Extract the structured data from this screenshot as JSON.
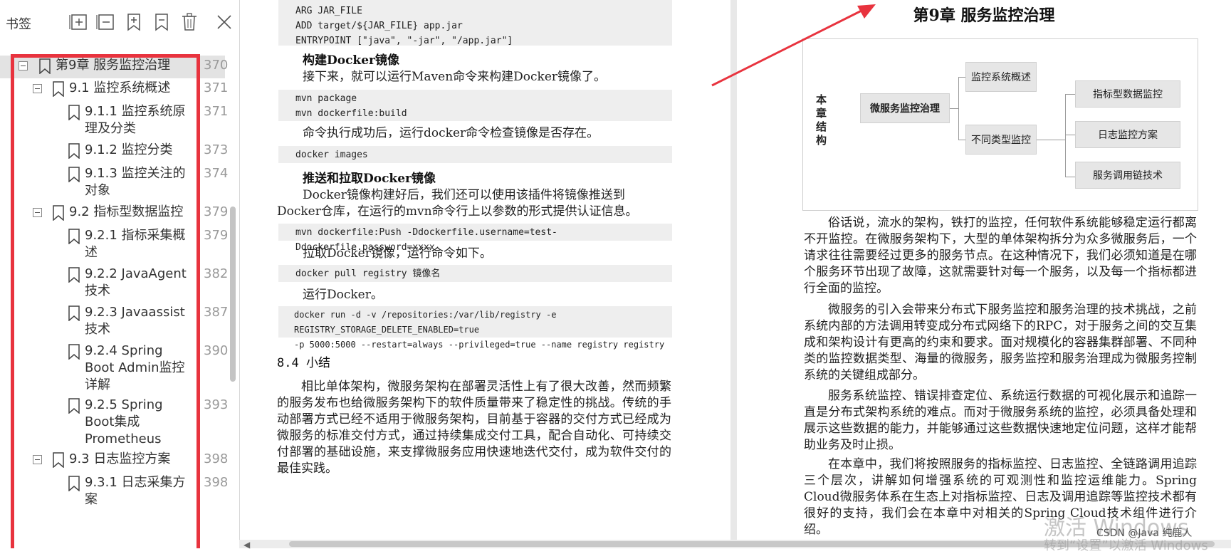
{
  "sidebar": {
    "title": "书签",
    "toolbar": [
      "expand-all-icon",
      "collapse-all-icon",
      "add-bookmark-icon",
      "remove-bookmark-icon",
      "delete-icon",
      "close-icon"
    ],
    "items": [
      {
        "label": "第9章 服务监控治理",
        "page": "370",
        "level": 0
      },
      {
        "label": "9.1 监控系统概述",
        "page": "371",
        "level": 1
      },
      {
        "label": "9.1.1 监控系统原理及分类",
        "page": "371",
        "level": 2
      },
      {
        "label": "9.1.2 监控分类",
        "page": "373",
        "level": 2
      },
      {
        "label": "9.1.3 监控关注的对象",
        "page": "374",
        "level": 2
      },
      {
        "label": "9.2 指标型数据监控",
        "page": "379",
        "level": 1
      },
      {
        "label": "9.2.1 指标采集概述",
        "page": "379",
        "level": 2
      },
      {
        "label": "9.2.2 JavaAgent技术",
        "page": "382",
        "level": 2
      },
      {
        "label": "9.2.3 Javaassist技术",
        "page": "387",
        "level": 2
      },
      {
        "label": "9.2.4 Spring Boot Admin监控详解",
        "page": "390",
        "level": 2
      },
      {
        "label": "9.2.5 Spring Boot集成Prometheus",
        "page": "393",
        "level": 2
      },
      {
        "label": "9.3 日志监控方案",
        "page": "398",
        "level": 1
      },
      {
        "label": "9.3.1 日志采集方案",
        "page": "398",
        "level": 2
      }
    ]
  },
  "left_page": {
    "code1": [
      "ARG JAR_FILE",
      "ADD target/${JAR_FILE} app.jar",
      "ENTRYPOINT [\"java\", \"-jar\", \"/app.jar\"]"
    ],
    "h_build": "构建Docker镜像",
    "p_build": "接下来，就可以运行Maven命令来构建Docker镜像了。",
    "code2": [
      "mvn package",
      "mvn dockerfile:build"
    ],
    "p_check": "命令执行成功后，运行docker命令检查镜像是否存在。",
    "code3": [
      "docker images"
    ],
    "h_push": "推送和拉取Docker镜像",
    "p_push1": "Docker镜像构建好后，我们还可以使用该插件将镜像推送到",
    "p_push2": "Docker仓库，在运行的mvn命令行上以参数的形式提供认证信息。",
    "code4": [
      "mvn dockerfile:Push -Ddockerfile.username=test-Ddockerfile.password=xxxx"
    ],
    "p_pull": "拉取Docker镜像，运行命令如下。",
    "code5": [
      "docker pull registry 镜像名"
    ],
    "p_run": "运行Docker。",
    "code6": [
      "docker run -d -v /repositories:/var/lib/registry -e REGISTRY_STORAGE_DELETE_ENABLED=true",
      "-p 5000:5000 --restart=always --privileged=true --name registry registry"
    ],
    "section": "8.4  小结",
    "summary": "相比单体架构，微服务架构在部署灵活性上有了很大改善，然而频繁的服务发布也给微服务架构下的软件质量带来了稳定性的挑战。传统的手动部署方式已经不适用于微服务架构，目前基于容器的交付方式已经成为微服务的标准交付方式，通过持续集成交付工具，配合自动化、可持续交付部署的基础设施，来支撑微服务应用快速地迭代交付，成为软件交付的最佳实践。"
  },
  "right_page": {
    "chapter_title": "第9章  服务监控治理",
    "diagram": {
      "side_label": "本章结构",
      "root": "微服务监控治理",
      "level1": [
        "监控系统概述",
        "不同类型监控"
      ],
      "level2": [
        "指标型数据监控",
        "日志监控方案",
        "服务调用链技术"
      ]
    },
    "paragraphs": [
      "俗话说，流水的架构，铁打的监控，任何软件系统能够稳定运行都离不开监控。在微服务架构下，大型的单体架构拆分为众多微服务后，一个请求往往需要经过更多的服务节点。在这种情况下，我们必须知道是在哪个服务环节出现了故障，这就需要针对每一个服务，以及每一个指标都进行全面的监控。",
      "微服务的引入会带来分布式下服务监控和服务治理的技术挑战，之前系统内部的方法调用转变成分布式网络下的RPC，对于服务之间的交互集成和架构设计有更高的约束和要求。面对规模化的容器集群部署、不同种类的监控数据类型、海量的微服务，服务监控和服务治理成为微服务控制系统的关键组成部分。",
      "服务系统监控、错误排查定位、系统运行数据的可视化展示和追踪一直是分布式架构系统的难点。而对于微服务系统的监控，必须具备处理和展示这些数据的能力，并能够通过这些数据快速地定位问题，这样才能帮助业务及时止损。",
      "在本章中，我们将按照服务的指标监控、日志监控、全链路调用追踪三个层次，讲解如何增强系统的可观测性和监控运维能力。Spring Cloud微服务体系在生态上对指标监控、日志及调用追踪等监控技术都有很好的支持，我们会在本章中对相关的Spring Cloud技术组件进行介绍。"
    ]
  },
  "overlay": {
    "watermark": "激活 Windows",
    "watermark_sub": "转到“设置”以激活 Windows",
    "csdn": "CSDN @Java 纯鹿人"
  },
  "colors": {
    "highlight": "#e8333e",
    "selected_row": "#e3e3e3"
  }
}
